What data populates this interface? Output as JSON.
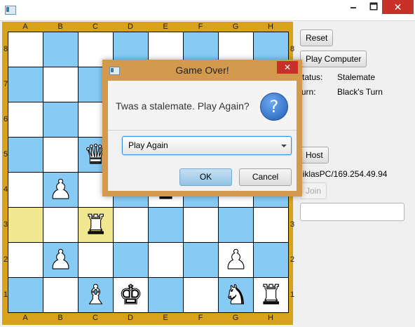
{
  "window": {
    "minimize": "🗕",
    "maximize": "🗖",
    "close": "✕"
  },
  "board": {
    "files": [
      "A",
      "B",
      "C",
      "D",
      "E",
      "F",
      "G",
      "H"
    ],
    "ranks": [
      "8",
      "7",
      "6",
      "5",
      "4",
      "3",
      "2",
      "1"
    ],
    "highlighted_squares": [
      "a3",
      "c3"
    ],
    "pieces": [
      {
        "square": "c5",
        "color": "white",
        "type": "queen",
        "glyph": "♛"
      },
      {
        "square": "b4",
        "color": "white",
        "type": "pawn",
        "glyph": "♟"
      },
      {
        "square": "e4",
        "color": "black",
        "type": "king",
        "glyph": "♚"
      },
      {
        "square": "c3",
        "color": "white",
        "type": "rook",
        "glyph": "♜"
      },
      {
        "square": "b2",
        "color": "white",
        "type": "pawn",
        "glyph": "♟"
      },
      {
        "square": "g2",
        "color": "white",
        "type": "pawn",
        "glyph": "♟"
      },
      {
        "square": "c1",
        "color": "white",
        "type": "bishop",
        "glyph": "♝"
      },
      {
        "square": "d1",
        "color": "white",
        "type": "king",
        "glyph": "♚"
      },
      {
        "square": "g1",
        "color": "white",
        "type": "knight",
        "glyph": "♞"
      },
      {
        "square": "h1",
        "color": "white",
        "type": "rook",
        "glyph": "♜"
      }
    ]
  },
  "panel": {
    "reset_label": "Reset",
    "play_computer_label": "Play Computer",
    "status_label": "Status:",
    "status_value": "Stalemate",
    "turn_label": "Turn:",
    "turn_value": "Black's Turn",
    "host_label": "Host",
    "address": "NiklasPC/169.254.49.94",
    "join_label": "Join",
    "join_input_value": ""
  },
  "dialog": {
    "title": "Game Over!",
    "close": "✕",
    "message": "Twas a stalemate. Play Again?",
    "question_glyph": "?",
    "selected_option": "Play Again",
    "ok_label": "OK",
    "cancel_label": "Cancel"
  }
}
